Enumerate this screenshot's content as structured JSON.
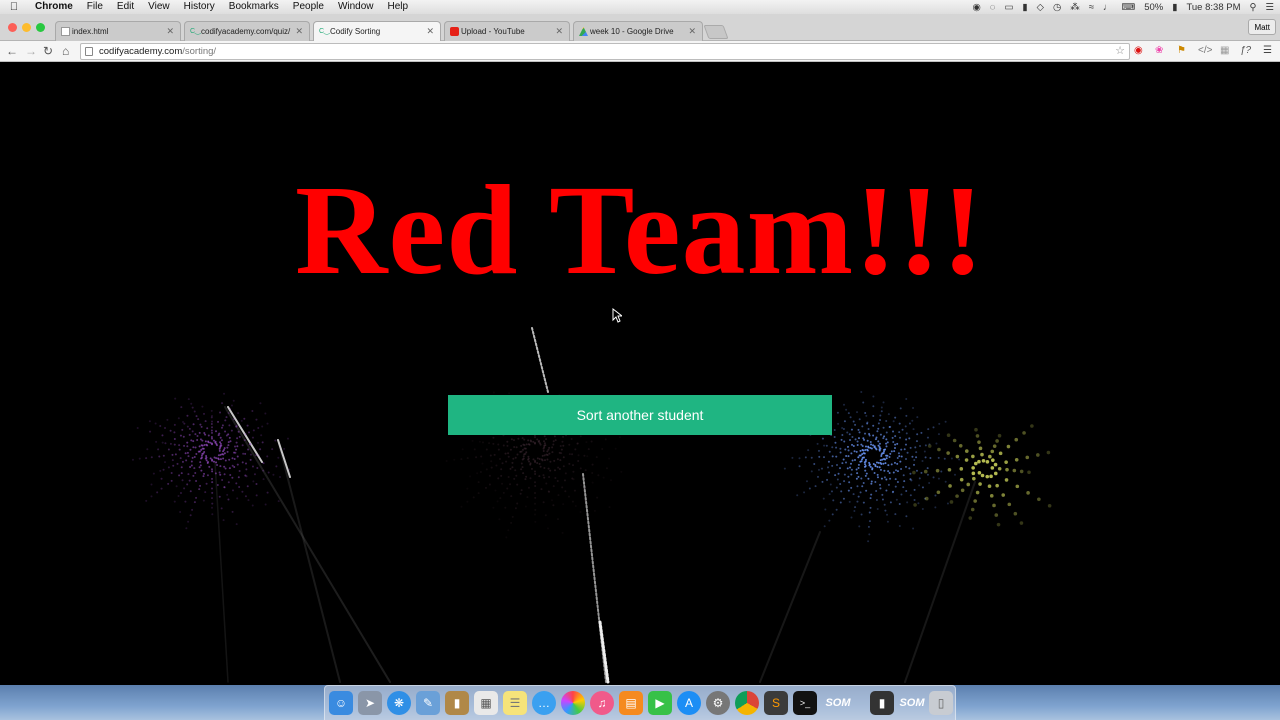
{
  "menubar": {
    "app_name": "Chrome",
    "items": [
      "File",
      "Edit",
      "View",
      "History",
      "Bookmarks",
      "People",
      "Window",
      "Help"
    ],
    "battery": "50%",
    "clock": "Tue 8:38 PM"
  },
  "tabs": [
    {
      "title": "index.html",
      "favicon": "file-icon",
      "active": false
    },
    {
      "title": "codifyacademy.com/quiz/",
      "favicon": "codify-icon",
      "active": false
    },
    {
      "title": "Codify Sorting",
      "favicon": "codify-icon",
      "active": true
    },
    {
      "title": "Upload - YouTube",
      "favicon": "youtube-icon",
      "active": false
    },
    {
      "title": "week 10 - Google Drive",
      "favicon": "google-drive-icon",
      "active": false
    }
  ],
  "profile": "Matt",
  "address": {
    "host": "codifyacademy.com",
    "path": "/sorting/"
  },
  "page": {
    "headline": "Red Team!!!",
    "button_label": "Sort another student"
  },
  "colors": {
    "headline": "#ff0000",
    "button": "#1fb582",
    "background": "#000000"
  },
  "dock": {
    "som_label_1": "SOM",
    "som_label_2": "SOM"
  }
}
